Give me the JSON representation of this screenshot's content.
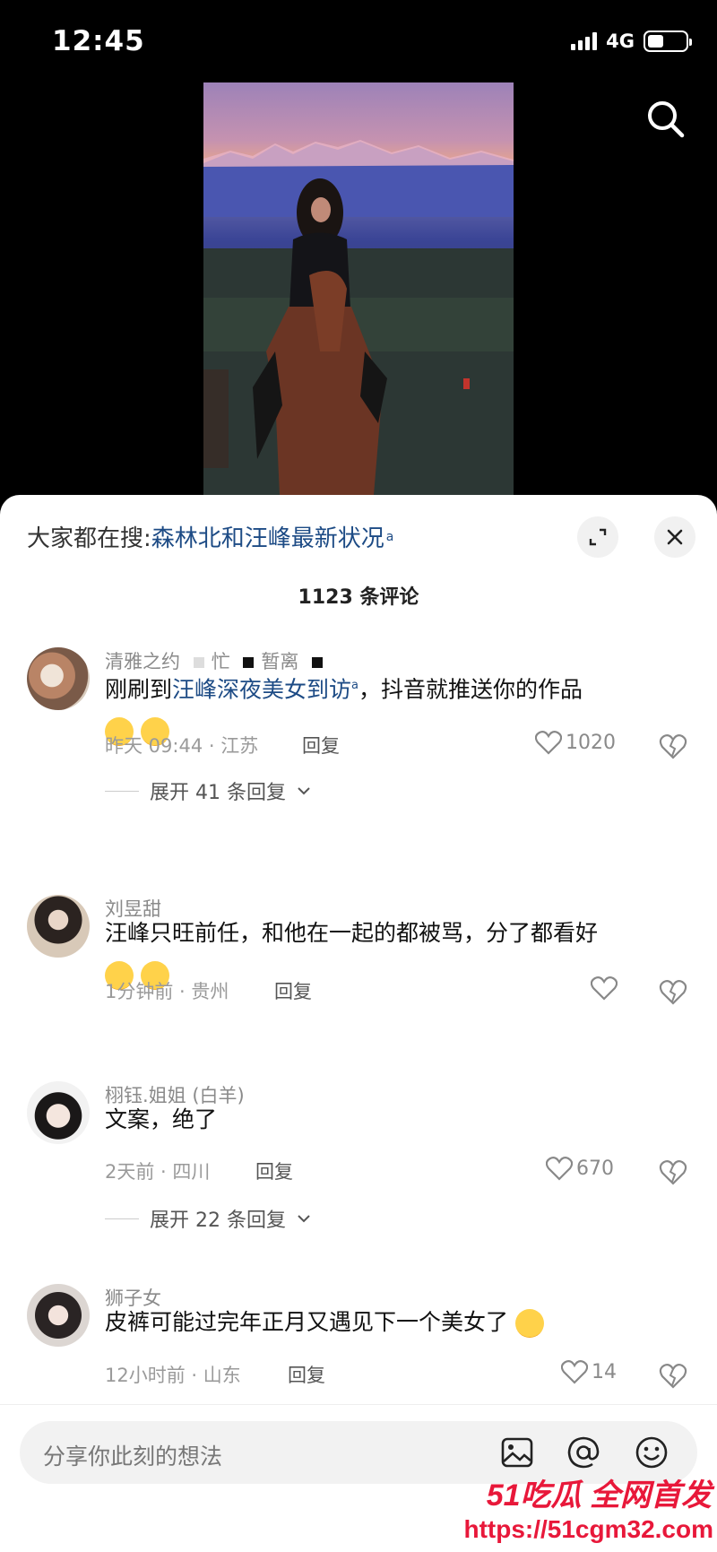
{
  "status_bar": {
    "time": "12:45",
    "network": "4G"
  },
  "sheet": {
    "hot_search_prefix": "大家都在搜:",
    "hot_search_term": "森林北和汪峰最新状况",
    "comment_count": "1123 条评论"
  },
  "comments": [
    {
      "username": "清雅之约",
      "username_extra_1": "忙",
      "username_extra_2": "暂离",
      "text_before": "刚刷到",
      "link": "汪峰深夜美女到访",
      "text_after": "，抖音就推送你的作品",
      "meta": "昨天 09:44 · 江苏",
      "reply": "回复",
      "likes": "1020",
      "expand": "展开 41 条回复"
    },
    {
      "username": "刘昱甜",
      "text": "汪峰只旺前任，和他在一起的都被骂，分了都看好",
      "meta": "1分钟前 · 贵州",
      "reply": "回复",
      "likes": ""
    },
    {
      "username": "栩钰.姐姐 (白羊)",
      "text": "文案，绝了",
      "meta": "2天前 · 四川",
      "reply": "回复",
      "likes": "670",
      "expand": "展开 22 条回复"
    },
    {
      "username": "狮子女",
      "text": "皮裤可能过完年正月又遇见下一个美女了",
      "meta": "12小时前 · 山东",
      "reply": "回复",
      "likes": "14"
    }
  ],
  "input": {
    "placeholder": "分享你此刻的想法"
  },
  "watermark": {
    "brand": "51吃瓜 全网首发",
    "url": "https://51cgm32.com"
  }
}
